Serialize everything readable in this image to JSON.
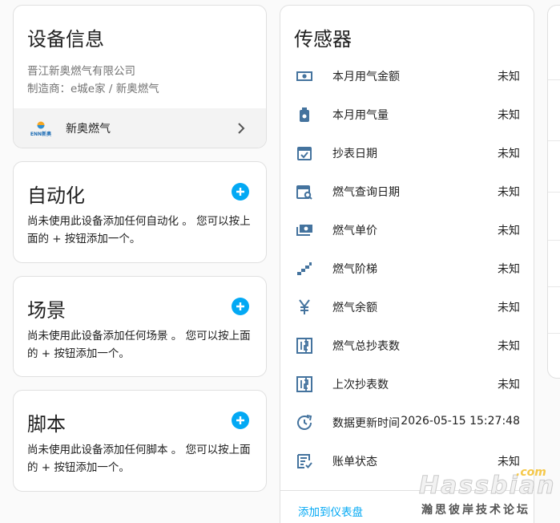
{
  "device": {
    "title": "设备信息",
    "company": "晋江新奥燃气有限公司",
    "manufacturer": "制造商：e城e家 / 新奥燃气",
    "logo_text": "ENN新奥",
    "name": "新奥燃气"
  },
  "automation": {
    "title": "自动化",
    "text": "尚未使用此设备添加任何自动化 。 您可以按上面的 + 按钮添加一个。"
  },
  "scene": {
    "title": "场景",
    "text": "尚未使用此设备添加任何场景 。 您可以按上面的 + 按钮添加一个。"
  },
  "script": {
    "title": "脚本",
    "text": "尚未使用此设备添加任何脚本 。 您可以按上面的 + 按钮添加一个。"
  },
  "sensors": {
    "title": "传感器",
    "items": [
      {
        "name": "本月用气金额",
        "value": "未知",
        "icon": "cash-icon"
      },
      {
        "name": "本月用气量",
        "value": "未知",
        "icon": "gas-canister-icon"
      },
      {
        "name": "抄表日期",
        "value": "未知",
        "icon": "calendar-check-icon"
      },
      {
        "name": "燃气查询日期",
        "value": "未知",
        "icon": "calendar-search-icon"
      },
      {
        "name": "燃气单价",
        "value": "未知",
        "icon": "cash-multiple-icon"
      },
      {
        "name": "燃气阶梯",
        "value": "未知",
        "icon": "stairs-icon"
      },
      {
        "name": "燃气余额",
        "value": "未知",
        "icon": "currency-cny-icon"
      },
      {
        "name": "燃气总抄表数",
        "value": "未知",
        "icon": "counter-icon"
      },
      {
        "name": "上次抄表数",
        "value": "未知",
        "icon": "counter-icon"
      },
      {
        "name": "数据更新时间",
        "value": "2026-05-15 15:27:48",
        "icon": "update-icon"
      },
      {
        "name": "账单状态",
        "value": "未知",
        "icon": "list-status-icon"
      }
    ],
    "add_to_dashboard": "添加到仪表盘"
  },
  "watermark": {
    "brand": "Hassbian",
    "com": ".com",
    "subtitle": "瀚思彼岸技术论坛"
  },
  "colors": {
    "accent": "#03a9f4",
    "icon": "#44739e",
    "secondary_text": "#727272"
  }
}
